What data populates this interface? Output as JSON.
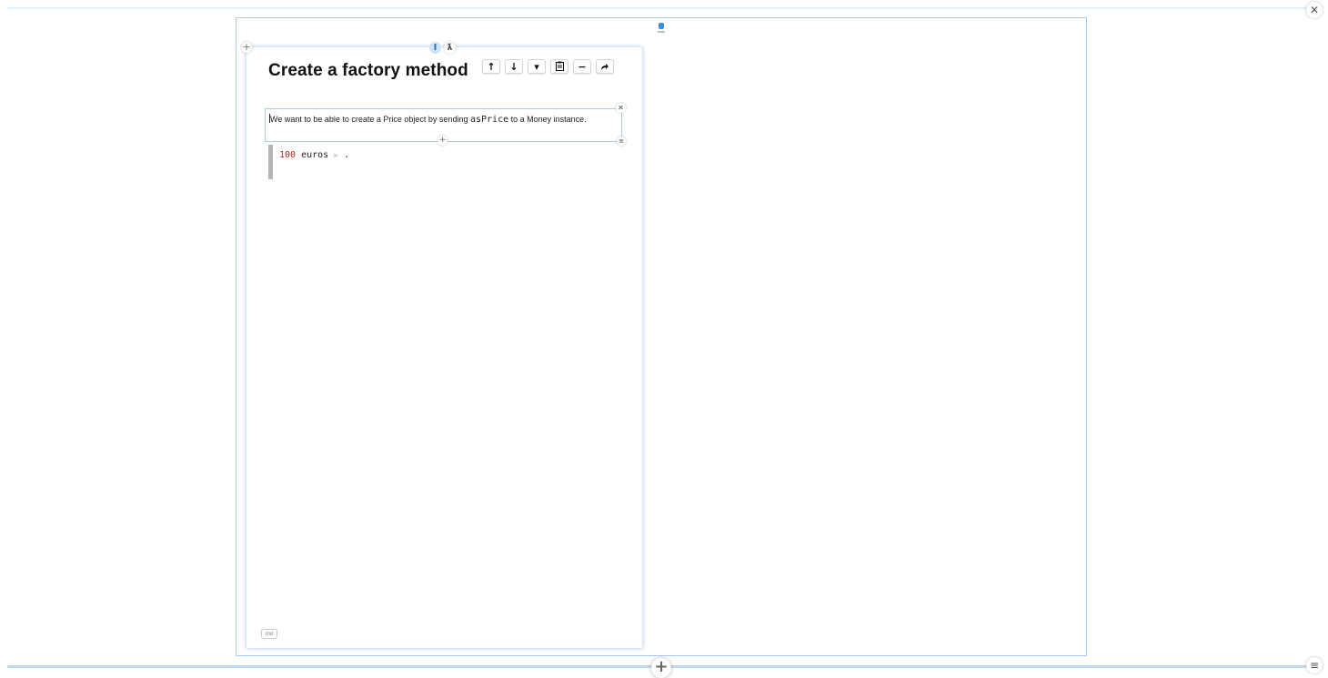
{
  "page": {
    "title": "Create a factory method"
  },
  "toolbar": {
    "move_up_icon": "↑",
    "move_down_icon": "↓",
    "dropdown_icon": "▾",
    "clipboard_icon": "📋",
    "minimize_icon": "−",
    "share_icon": "↗"
  },
  "text_snippet": {
    "text_before": "We want to be able to create a Price object by sending ",
    "code": "asPrice",
    "text_after": " to a Money instance."
  },
  "code_snippet": {
    "number": "100",
    "message": " euros",
    "period": " ."
  },
  "badge": {
    "label": "md"
  },
  "colors": {
    "accent": "#a9cdee",
    "number": "#b32424"
  }
}
